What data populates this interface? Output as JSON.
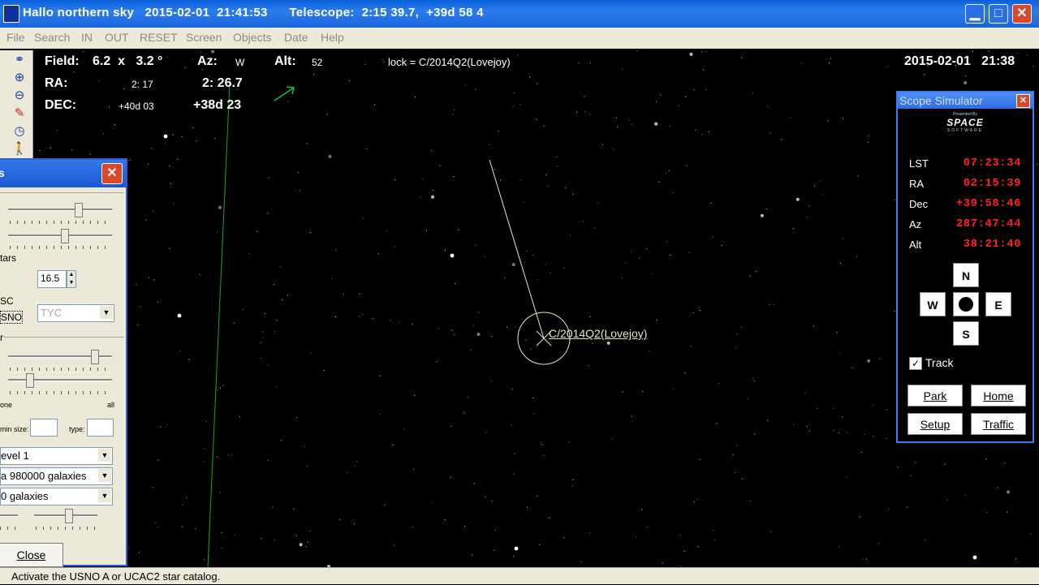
{
  "window": {
    "title": "Hallo northern sky   2015-02-01  21:41:53      Telescope:  2:15 39.7,  +39d 58 4",
    "min_label": "▁",
    "max_label": "□",
    "close_label": "✕"
  },
  "menu": [
    "File",
    "Search",
    "IN",
    "OUT",
    "RESET",
    "Screen",
    "Objects",
    "Date",
    "Help"
  ],
  "hud": {
    "field_label": "Field:",
    "field_value": "6.2  x   3.2 °",
    "az_label": "Az:",
    "az_value": "W",
    "alt_label": "Alt:",
    "alt_value": "52",
    "lock_text": "lock = C/2014Q2(Lovejoy)",
    "datetime": "2015-02-01   21:38",
    "ra_label": "RA:",
    "ra_small": "2: 17",
    "ra_value": "2: 26.7",
    "dec_label": "DEC:",
    "dec_small": "+40d 03",
    "dec_value": "+38d 23"
  },
  "sky": {
    "object_label": "C/2014Q2(Lovejoy)",
    "colors": {
      "target": "#e6e6c8",
      "grid_line": "#22a02a",
      "compass": "#22c040"
    }
  },
  "toolbar": {
    "icons": [
      "binoculars-icon",
      "zoom-in-icon",
      "zoom-out-icon",
      "pencil-icon",
      "clock-icon",
      "walker-icon"
    ]
  },
  "dialog": {
    "title_partial": "s",
    "stars_label": "tars",
    "mag_value": "16.5",
    "gsc_label": "SC",
    "usno_label": "SNO",
    "tyc_value": "TYC",
    "section_label": "r",
    "none_label": "one",
    "all_label": "all",
    "min_size_label": "min size:",
    "type_label": "type:",
    "combo1": "evel 1",
    "combo2": "a 980000 galaxies",
    "combo3": "0 galaxies",
    "close_label": "Close"
  },
  "scope": {
    "title": "Scope Simulator",
    "logo_small": "Presented By",
    "logo_main": "SPACE",
    "logo_sub": "SOFTWARE",
    "lst_label": "LST",
    "lst_value": "07:23:34",
    "ra_label": "RA",
    "ra_value": "02:15:39",
    "dec_label": "Dec",
    "dec_value": "+39:58:46",
    "az_label": "Az",
    "az_value": "287:47:44",
    "alt_label": "Alt",
    "alt_value": "38:21:40",
    "n": "N",
    "s": "S",
    "e": "E",
    "w": "W",
    "track_label": "Track",
    "track_checked": "✓",
    "park_label": "Park",
    "home_label": "Home",
    "setup_label": "Setup",
    "traffic_label": "Traffic"
  },
  "status": "Activate the USNO A or UCAC2 star catalog."
}
